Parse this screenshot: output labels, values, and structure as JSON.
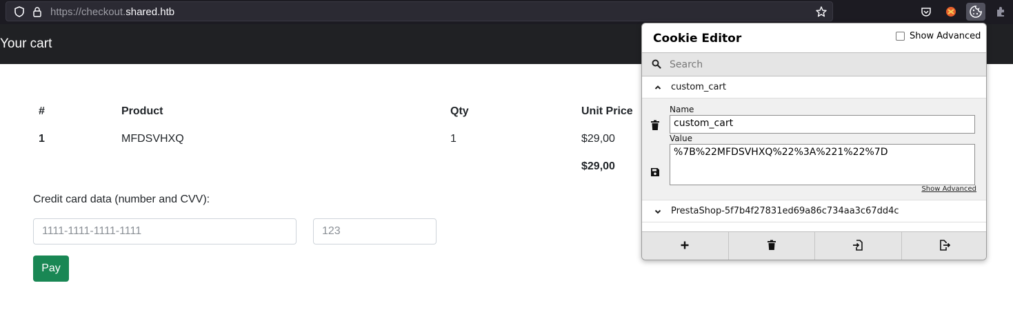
{
  "browser": {
    "url_prefix": "https://checkout.",
    "url_domain": "shared.htb",
    "icons": [
      "shield-icon",
      "lock-icon",
      "star-icon",
      "pocket-icon",
      "extension-icon",
      "cookie-icon",
      "puzzle-icon"
    ]
  },
  "page": {
    "title": "Your cart",
    "table": {
      "headers": [
        "#",
        "Product",
        "Qty",
        "Unit Price"
      ],
      "rows": [
        {
          "num": "1",
          "product": "MFDSVHXQ",
          "qty": "1",
          "price": "$29,00"
        }
      ],
      "total": "$29,00"
    },
    "cc_label": "Credit card data (number and CVV):",
    "cc_number_placeholder": "1111-1111-1111-1111",
    "cvv_placeholder": "123",
    "pay_label": "Pay",
    "pay_color": "#198754"
  },
  "cookie_editor": {
    "title": "Cookie Editor",
    "show_advanced_label": "Show Advanced",
    "search_placeholder": "Search",
    "cookies": [
      {
        "name": "custom_cart",
        "expanded": true
      },
      {
        "name": "PrestaShop-5f7b4f27831ed69a86c734aa3c67dd4c",
        "expanded": false
      }
    ],
    "name_label": "Name",
    "name_value": "custom_cart",
    "value_label": "Value",
    "value_value": "%7B%22MFDSVHXQ%22%3A%221%22%7D",
    "show_advanced_link": "Show Advanced",
    "footer_buttons": [
      "add-icon",
      "delete-all-icon",
      "import-icon",
      "export-icon"
    ]
  }
}
